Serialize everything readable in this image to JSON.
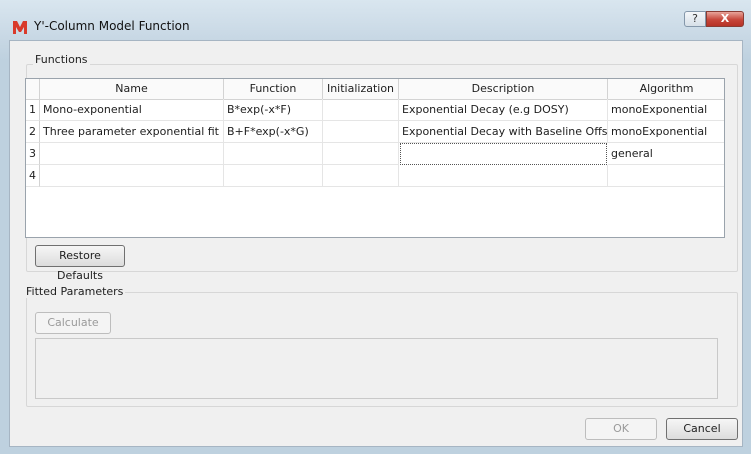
{
  "window": {
    "title": "Y'-Column Model Function",
    "help_label": "?",
    "close_label": "X"
  },
  "functions_group": {
    "label": "Functions"
  },
  "table": {
    "headers": [
      "",
      "Name",
      "Function",
      "Initialization",
      "Description",
      "Algorithm"
    ],
    "rows": [
      {
        "num": "1",
        "name": "Mono-exponential",
        "function": "B*exp(-x*F)",
        "initialization": "",
        "description": "Exponential Decay (e.g DOSY)",
        "algorithm": "monoExponential"
      },
      {
        "num": "2",
        "name": "Three parameter exponential fit",
        "function": "B+F*exp(-x*G)",
        "initialization": "",
        "description": "Exponential Decay with Baseline Offset",
        "algorithm": "monoExponential"
      },
      {
        "num": "3",
        "name": "",
        "function": "",
        "initialization": "",
        "description": "",
        "algorithm": "general"
      },
      {
        "num": "4",
        "name": "",
        "function": "",
        "initialization": "",
        "description": "",
        "algorithm": ""
      }
    ]
  },
  "buttons": {
    "restore_defaults": "Restore Defaults",
    "calculate": "Calculate",
    "ok": "OK",
    "cancel": "Cancel"
  },
  "fitted_group": {
    "label": "Fitted Parameters"
  },
  "colors": {
    "title_bar": "#c7d7e4",
    "close": "#c7463a",
    "app_icon": "#d93a2b"
  },
  "icons": {
    "app": "app-logo-icon",
    "help": "help-icon",
    "close": "close-icon"
  }
}
